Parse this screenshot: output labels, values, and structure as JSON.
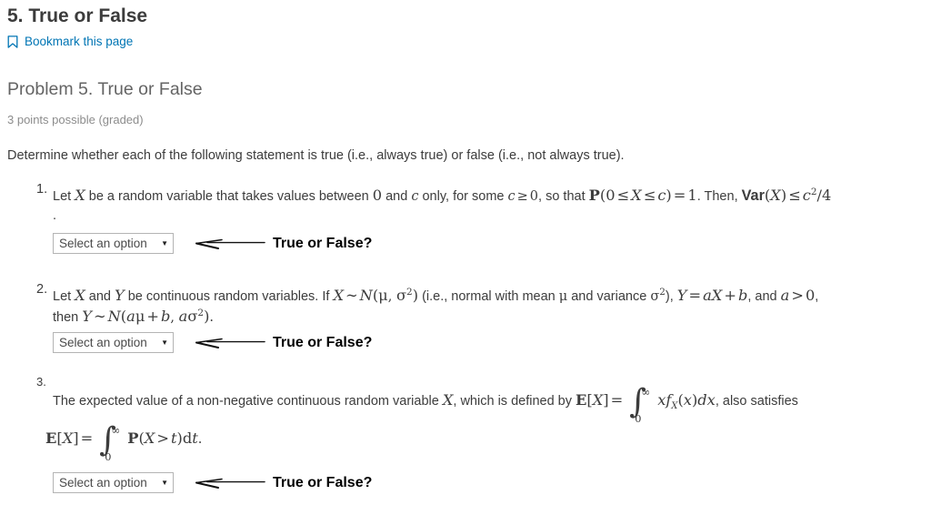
{
  "header": {
    "unit_title": "5. True or False",
    "bookmark_label": "Bookmark this page",
    "bookmark_icon": "bookmark-icon",
    "bookmark_color": "#0075b4"
  },
  "problem": {
    "title": "Problem 5. True or False",
    "points": "3 points possible (graded)",
    "intro": "Determine whether each of the following statement is true (i.e., always true) or false (i.e., not always true)."
  },
  "questions": [
    {
      "marker": "1.",
      "statement_plain": "Let X be a random variable that takes values between 0 and c only, for some c ≥ 0, so that P(0 ≤ X ≤ c) = 1. Then, Var(X) ≤ c²/4",
      "trailing_text": ".",
      "select": {
        "value": "Select an option",
        "caret": "▼"
      },
      "annotation": "True or False?",
      "arrow_icon": "left-arrow-annotation-icon"
    },
    {
      "marker": "2.",
      "statement_plain": "Let X and Y be continuous random variables. If X ~ N(μ, σ²) (i.e., normal with mean μ and variance σ²), Y = aX + b, and a > 0, then Y ~ N(aμ + b, aσ²).",
      "select": {
        "value": "Select an option",
        "caret": "▼"
      },
      "annotation": "True or False?",
      "arrow_icon": "left-arrow-annotation-icon"
    },
    {
      "marker": "3.",
      "statement_plain": "The expected value of a non-negative continuous random variable X, which is defined by E[X] = ∫₀^∞ x f_X(x)dx, also satisfies E[X] = ∫₀^∞ P(X > t)dt.",
      "select": {
        "value": "Select an option",
        "caret": "▼"
      },
      "annotation": "True or False?",
      "arrow_icon": "left-arrow-annotation-icon"
    }
  ],
  "text_fragments": {
    "q1": {
      "a": "Let ",
      "b": " be a random variable that takes values between ",
      "c": " and ",
      "d": " only, for some ",
      "e": ", so that ",
      "f": ". Then, "
    },
    "q2": {
      "a": "Let ",
      "b": " and ",
      "c": " be continuous random variables. If ",
      "d": " (i.e., normal with mean ",
      "e": " and variance ",
      "f": "), ",
      "g": ", and ",
      "h": ",",
      "i": "then "
    },
    "q3": {
      "a": "The expected value of a non-negative continuous random variable ",
      "b": ", which is defined by ",
      "c": ", also satisfies"
    }
  },
  "colors": {
    "text": "#3c3c3c",
    "muted": "#8c8c8c",
    "heading_muted": "#646464",
    "link": "#0075b4",
    "border": "#b4b4b4",
    "background": "#ffffff"
  }
}
